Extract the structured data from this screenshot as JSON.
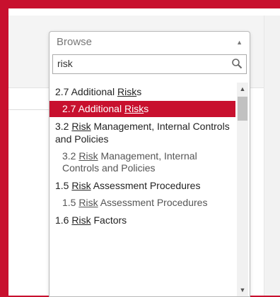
{
  "dropdown": {
    "selected_label": "Browse",
    "search": {
      "value": "risk",
      "placeholder": ""
    },
    "highlight": "Risk",
    "results": [
      {
        "kind": "group",
        "pre": "2.7 Additional ",
        "match": "Risk",
        "post": "s"
      },
      {
        "kind": "option",
        "pre": "2.7 Additional ",
        "match": "Risk",
        "post": "s",
        "selected": true
      },
      {
        "kind": "group",
        "pre": "3.2 ",
        "match": "Risk",
        "post": " Management, Internal Controls and Policies"
      },
      {
        "kind": "option",
        "pre": "3.2 ",
        "match": "Risk",
        "post": " Management, Internal Controls and Policies",
        "selected": false
      },
      {
        "kind": "group",
        "pre": "1.5 ",
        "match": "Risk",
        "post": " Assessment Procedures"
      },
      {
        "kind": "option",
        "pre": "1.5 ",
        "match": "Risk",
        "post": " Assessment Procedures",
        "selected": false
      },
      {
        "kind": "group",
        "pre": "1.6 ",
        "match": "Risk",
        "post": " Factors"
      }
    ]
  },
  "colors": {
    "accent": "#c8102e"
  }
}
